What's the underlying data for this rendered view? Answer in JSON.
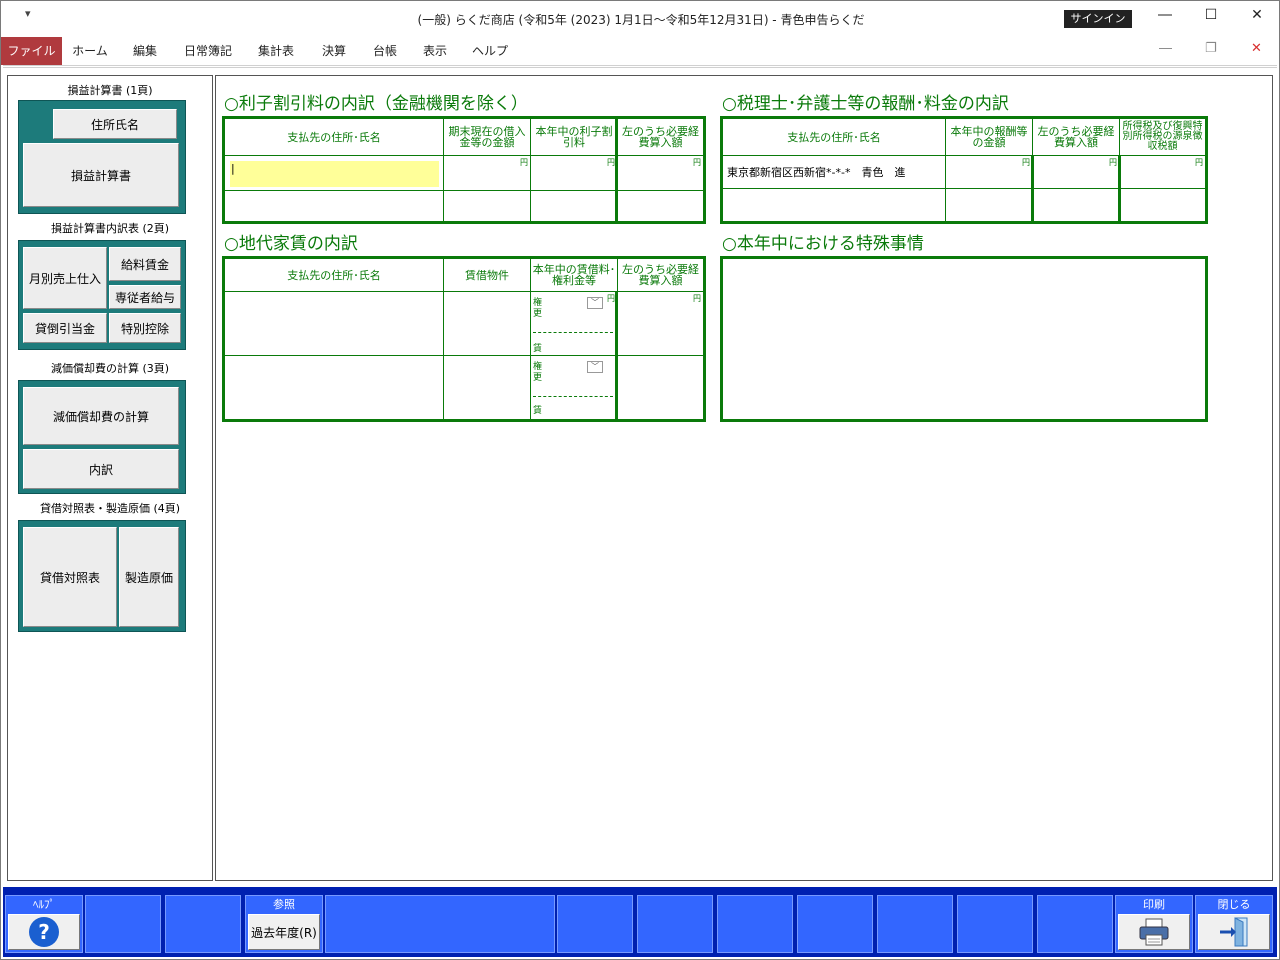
{
  "title": "(一般) らくだ商店 (令和5年 (2023) 1月1日～令和5年12月31日)  -  青色申告らくだ",
  "qa": "▾",
  "signin": "サインイン",
  "menu": [
    "ファイル",
    "ホーム",
    "編集",
    "日常簿記",
    "集計表",
    "決算",
    "台帳",
    "表示",
    "ヘルプ"
  ],
  "sidebar": {
    "g1": {
      "label": "損益計算書 (1頁)",
      "btn1": "住所氏名",
      "btn2": "損益計算書"
    },
    "g2": {
      "label": "損益計算書内訳表 (2頁)",
      "btn1": "月別売上仕入",
      "btn2": "給料賃金",
      "btn3": "専従者給与",
      "btn4": "貸倒引当金",
      "btn5": "特別控除"
    },
    "g3": {
      "label": "減価償却費の計算 (3頁)",
      "btn1": "減価償却費の計算",
      "btn2": "内訳"
    },
    "g4": {
      "label": "貸借対照表・製造原価 (4頁)",
      "btn1": "貸借対照表",
      "btn2": "製造原価"
    }
  },
  "sec1": {
    "title": "○利子割引料の内訳（金融機関を除く）",
    "h1": "支払先の住所･氏名",
    "h2": "期末現在の借入金等の金額",
    "h3": "本年中の利子割引料",
    "h4": "左のうち必要経費算入額",
    "yen": "円",
    "input_value": "|"
  },
  "sec2": {
    "title": "○税理士･弁護士等の報酬･料金の内訳",
    "h1": "支払先の住所･氏名",
    "h2": "本年中の報酬等の金額",
    "h3": "左のうち必要経費算入額",
    "h4": "所得税及び復興特別所得税の源泉徴収税額",
    "row1": "東京都新宿区西新宿*-*-*　青色　進",
    "yen": "円"
  },
  "sec3": {
    "title": "○地代家賃の内訳",
    "h1": "支払先の住所･氏名",
    "h2": "賃借物件",
    "h3": "本年中の賃借料･権利金等",
    "h4": "左のうち必要経費算入額",
    "k1": "権",
    "k2": "更",
    "k3": "賃",
    "yen": "円"
  },
  "sec4": {
    "title": "○本年中における特殊事情"
  },
  "fkeys": {
    "help": "ﾍﾙﾌﾟ",
    "ref": "参照",
    "past": "過去年度(R)",
    "print": "印刷",
    "close": "閉じる"
  }
}
